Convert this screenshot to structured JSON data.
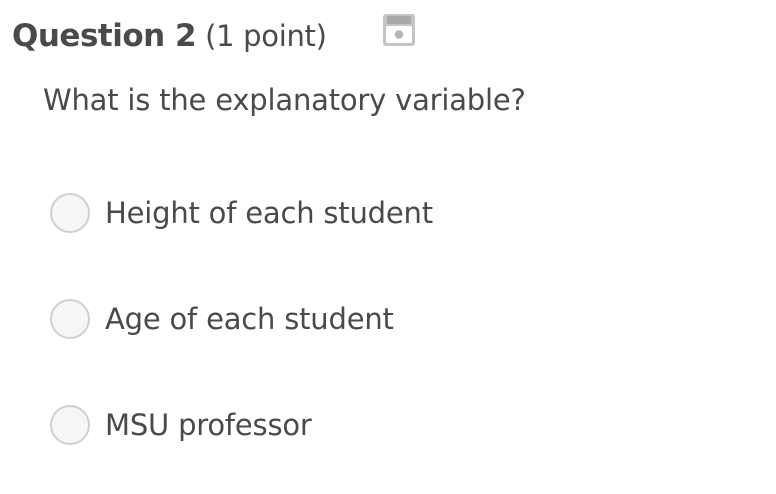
{
  "question": {
    "title": "Question 2",
    "points": "(1 point)",
    "save_icon": "save-disk-icon",
    "text": "What is the explanatory variable?"
  },
  "options": [
    {
      "label": "Height of each student",
      "selected": false
    },
    {
      "label": "Age of each student",
      "selected": false
    },
    {
      "label": "MSU professor",
      "selected": false
    }
  ],
  "colors": {
    "text": "#4a4a4a",
    "radio_border": "#cfcfcf",
    "radio_fill": "#f6f6f6",
    "icon": "#bdbdbd"
  }
}
